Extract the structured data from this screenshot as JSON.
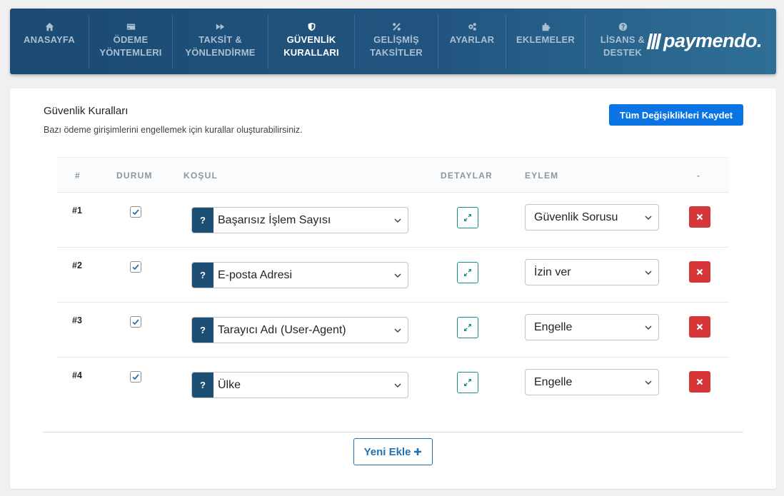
{
  "nav": {
    "items": [
      {
        "label": "ANASAYFA",
        "icon": "home-icon",
        "active": false
      },
      {
        "label": "ÖDEME\nYÖNTEMLERI",
        "icon": "credit-card-icon",
        "active": false
      },
      {
        "label": "TAKSİT &\nYÖNLENDİRME",
        "icon": "forward-icon",
        "active": false
      },
      {
        "label": "GÜVENLİK\nKURALLARI",
        "icon": "shield-icon",
        "active": true
      },
      {
        "label": "GELİŞMİŞ\nTAKSİTLER",
        "icon": "percent-icon",
        "active": false
      },
      {
        "label": "AYARLAR",
        "icon": "gears-icon",
        "active": false
      },
      {
        "label": "EKLEMELER",
        "icon": "puzzle-icon",
        "active": false
      },
      {
        "label": "LİSANS &\nDESTEK",
        "icon": "question-circle-icon",
        "active": false
      }
    ],
    "brand": "paymendo."
  },
  "card": {
    "title": "Güvenlik Kuralları",
    "description": "Bazı ödeme girişimlerini engellemek için kurallar oluşturabilirsiniz.",
    "save_label": "Tüm Değişiklikleri Kaydet"
  },
  "table": {
    "headers": {
      "num": "#",
      "status": "DURUM",
      "condition": "KOŞUL",
      "details": "DETAYLAR",
      "action": "EYLEM",
      "remove": "-"
    },
    "rows": [
      {
        "num": "#1",
        "enabled": true,
        "condition": "Başarısız İşlem Sayısı",
        "action": "Güvenlik Sorusu"
      },
      {
        "num": "#2",
        "enabled": true,
        "condition": "E-posta Adresi",
        "action": "İzin ver"
      },
      {
        "num": "#3",
        "enabled": true,
        "condition": "Tarayıcı Adı (User-Agent)",
        "action": "Engelle"
      },
      {
        "num": "#4",
        "enabled": true,
        "condition": "Ülke",
        "action": "Engelle"
      }
    ]
  },
  "add_button_label": "Yeni Ekle",
  "colors": {
    "nav_bg": "#1b4a72",
    "primary_blue": "#0b74e5",
    "help_badge": "#1d4e74",
    "detail_teal": "#12908c",
    "delete_red": "#d63638",
    "outline_blue": "#2271b1"
  }
}
